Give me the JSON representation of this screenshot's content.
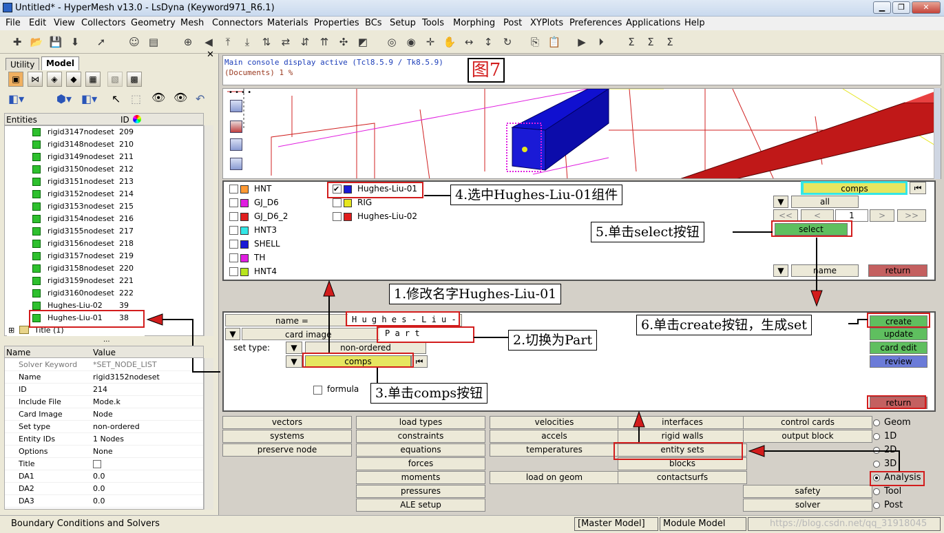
{
  "window": {
    "title": "Untitled* - HyperMesh v13.0 - LsDyna (Keyword971_R6.1)",
    "min": "▁",
    "max": "❐",
    "close": "✕"
  },
  "menus": [
    "File",
    "Edit",
    "View",
    "Collectors",
    "Geometry",
    "Mesh",
    "Connectors",
    "Materials",
    "Properties",
    "BCs",
    "Setup",
    "Tools",
    "Morphing",
    "Post",
    "XYPlots",
    "Preferences",
    "Applications",
    "Help"
  ],
  "left": {
    "tab_utility": "Utility",
    "tab_model": "Model",
    "col_entities": "Entities",
    "col_id": "ID",
    "entities": [
      {
        "n": "rigid3147nodeset",
        "id": "209"
      },
      {
        "n": "rigid3148nodeset",
        "id": "210"
      },
      {
        "n": "rigid3149nodeset",
        "id": "211"
      },
      {
        "n": "rigid3150nodeset",
        "id": "212"
      },
      {
        "n": "rigid3151nodeset",
        "id": "213"
      },
      {
        "n": "rigid3152nodeset",
        "id": "214"
      },
      {
        "n": "rigid3153nodeset",
        "id": "215"
      },
      {
        "n": "rigid3154nodeset",
        "id": "216"
      },
      {
        "n": "rigid3155nodeset",
        "id": "217"
      },
      {
        "n": "rigid3156nodeset",
        "id": "218"
      },
      {
        "n": "rigid3157nodeset",
        "id": "219"
      },
      {
        "n": "rigid3158nodeset",
        "id": "220"
      },
      {
        "n": "rigid3159nodeset",
        "id": "221"
      },
      {
        "n": "rigid3160nodeset",
        "id": "222"
      },
      {
        "n": "Hughes-Liu-02",
        "id": "39"
      },
      {
        "n": "Hughes-Liu-01",
        "id": "38"
      }
    ],
    "title_row": "Title (1)",
    "dots": "...",
    "col_name": "Name",
    "col_value": "Value",
    "props": [
      {
        "k": "Solver Keyword",
        "v": "*SET_NODE_LIST"
      },
      {
        "k": "Name",
        "v": "rigid3152nodeset"
      },
      {
        "k": "ID",
        "v": "214"
      },
      {
        "k": "Include File",
        "v": "Mode.k"
      },
      {
        "k": "Card Image",
        "v": "Node"
      },
      {
        "k": "Set type",
        "v": "non-ordered"
      },
      {
        "k": "Entity IDs",
        "v": "1 Nodes"
      },
      {
        "k": "Options",
        "v": "None"
      },
      {
        "k": "Title",
        "v": ""
      },
      {
        "k": "DA1",
        "v": "0.0"
      },
      {
        "k": "DA2",
        "v": "0.0"
      },
      {
        "k": "DA3",
        "v": "0.0"
      }
    ]
  },
  "console": {
    "line1": "Main console display active (Tcl8.5.9 / Tk8.5.9)",
    "line2": "(Documents) 1 %",
    "fig": "图7"
  },
  "select": {
    "items_left": [
      {
        "n": "HNT",
        "c": "#ff9933"
      },
      {
        "n": "GJ_D6",
        "c": "#e01ee0"
      },
      {
        "n": "GJ_D6_2",
        "c": "#e01e1e"
      },
      {
        "n": "HNT3",
        "c": "#33e6e6"
      },
      {
        "n": "SHELL",
        "c": "#1a1ad6"
      },
      {
        "n": "TH",
        "c": "#e01ee0"
      },
      {
        "n": "HNT4",
        "c": "#b8e61e"
      }
    ],
    "items_right": [
      {
        "n": "Hughes-Liu-01",
        "c": "#1a1ad6",
        "checked": true
      },
      {
        "n": "RIG",
        "c": "#e6e61e"
      },
      {
        "n": "Hughes-Liu-02",
        "c": "#e01e1e"
      }
    ],
    "comps": "comps",
    "all": "all",
    "page": "1",
    "select": "select",
    "name": "name",
    "return": "return",
    "first": "<<",
    "prev": "<",
    "next": ">",
    "last": ">>"
  },
  "create": {
    "name_label": "name =",
    "name_value": "H u g h e s - L i u -",
    "card_label": "card image",
    "card_value": "P a r t",
    "settype_label": "set type:",
    "settype_value": "non-ordered",
    "comps": "comps",
    "formula": "formula",
    "create": "create",
    "update": "update",
    "card_edit": "card edit",
    "review": "review",
    "return": "return"
  },
  "grid": [
    [
      "vectors",
      "load types",
      "velocities",
      "interfaces",
      "control cards"
    ],
    [
      "systems",
      "constraints",
      "accels",
      "rigid walls",
      "output block"
    ],
    [
      "preserve node",
      "equations",
      "temperatures",
      "entity sets",
      ""
    ],
    [
      "",
      "forces",
      "",
      "blocks",
      ""
    ],
    [
      "",
      "moments",
      "load on geom",
      "contactsurfs",
      ""
    ],
    [
      "",
      "pressures",
      "",
      "",
      "safety"
    ],
    [
      "",
      "ALE setup",
      "",
      "",
      "solver"
    ]
  ],
  "radios": [
    "Geom",
    "1D",
    "2D",
    "3D",
    "Analysis",
    "Tool",
    "Post"
  ],
  "status": {
    "left": "Boundary Conditions and Solvers",
    "master": "[Master Model]",
    "module": "Module Model",
    "watermark": "https://blog.csdn.net/qq_31918045"
  },
  "annotations": {
    "a1": "1.修改名字Hughes-Liu-01",
    "a2": "2.切换为Part",
    "a3": "3.单击comps按钮",
    "a4": "4.选中Hughes-Liu-01组件",
    "a5": "5.单击select按钮",
    "a6": "6.单击create按钮，生成set"
  }
}
